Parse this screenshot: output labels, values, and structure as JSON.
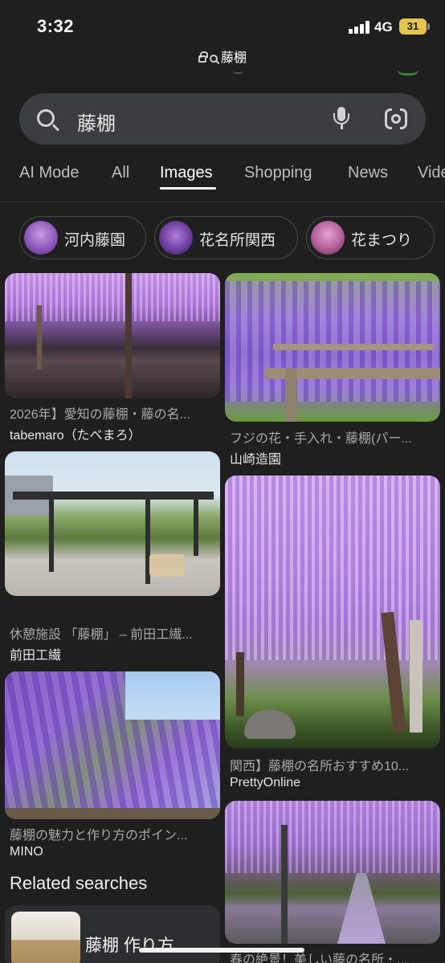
{
  "status_bar": {
    "time": "3:32",
    "network": "4G",
    "battery": "31"
  },
  "browser": {
    "url_text": "藤棚"
  },
  "search": {
    "query": "藤棚"
  },
  "tabs": [
    {
      "label": "AI Mode",
      "active": false
    },
    {
      "label": "All",
      "active": false
    },
    {
      "label": "Images",
      "active": true
    },
    {
      "label": "Shopping",
      "active": false
    },
    {
      "label": "News",
      "active": false
    },
    {
      "label": "Vide",
      "active": false
    }
  ],
  "chips": [
    {
      "label": "河内藤園"
    },
    {
      "label": "花名所関西"
    },
    {
      "label": "花まつり"
    }
  ],
  "results": [
    {
      "title": "2026年】愛知の藤棚・藤の名...",
      "source": "tabemaro（たべまろ）"
    },
    {
      "title": "フジの花・手入れ・藤棚(パー...",
      "source": "山崎造園"
    },
    {
      "title": "休憩施設 「藤棚」 – 前田工繊...",
      "source": "前田工繊"
    },
    {
      "title": "関西】藤棚の名所おすすめ10...",
      "source": "PrettyOnline"
    },
    {
      "title": "藤棚の魅力と作り方のポイン...",
      "source": "MINO"
    },
    {
      "title": "春の絶景！美しい藤の名所・...",
      "source": ""
    }
  ],
  "related": {
    "heading": "Related searches",
    "items": [
      {
        "label": "藤棚 作り方"
      }
    ]
  },
  "colors": {
    "background": "#1f1f1f",
    "search_bg": "#3c3d40",
    "wisteria": "#a77ad0"
  }
}
